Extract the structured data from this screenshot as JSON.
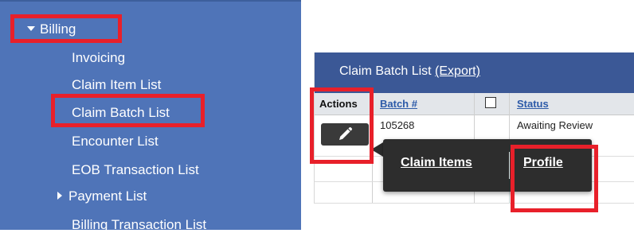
{
  "sidebar": {
    "section_label": "Billing",
    "items": [
      {
        "label": "Invoicing"
      },
      {
        "label": "Claim Item List"
      },
      {
        "label": "Claim Batch List"
      },
      {
        "label": "Encounter List"
      },
      {
        "label": "EOB Transaction List"
      },
      {
        "label": "Payment List"
      },
      {
        "label": "Billing Transaction List"
      }
    ]
  },
  "panel": {
    "title": "Claim Batch List",
    "export_label": "(Export)",
    "columns": {
      "actions": "Actions",
      "batch": "Batch #",
      "status": "Status"
    },
    "rows": [
      {
        "batch": "105268",
        "status": "Awaiting Review"
      }
    ]
  },
  "popup": {
    "option_claim_items": "Claim Items",
    "option_profile": "Profile"
  },
  "colors": {
    "sidebar_bg": "#4f74b8",
    "panel_header_bg": "#3b5896",
    "highlight_red": "#e8202a",
    "popup_bg": "#2d2d2d"
  }
}
